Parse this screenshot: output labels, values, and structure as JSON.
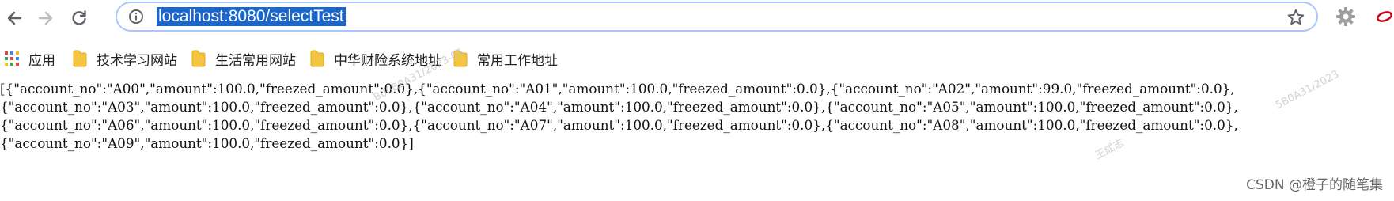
{
  "browser": {
    "url": "localhost:8080/selectTest",
    "icons": {
      "back": "back-arrow-icon",
      "forward": "forward-arrow-icon",
      "reload": "reload-icon",
      "info": "info-icon",
      "bookmark_star": "star-icon",
      "extension": "gear-icon"
    }
  },
  "bookmarks": [
    {
      "label": "应用",
      "icon": "apps-grid-icon"
    },
    {
      "label": "技术学习网站",
      "icon": "folder-icon"
    },
    {
      "label": "生活常用网站",
      "icon": "folder-icon"
    },
    {
      "label": "中华财险系统地址",
      "icon": "folder-icon"
    },
    {
      "label": "常用工作地址",
      "icon": "folder-icon"
    }
  ],
  "content": {
    "lines": [
      "[{\"account_no\":\"A00\",\"amount\":100.0,\"freezed_amount\":0.0},{\"account_no\":\"A01\",\"amount\":100.0,\"freezed_amount\":0.0},{\"account_no\":\"A02\",\"amount\":99.0,\"freezed_amount\":0.0},",
      "{\"account_no\":\"A03\",\"amount\":100.0,\"freezed_amount\":0.0},{\"account_no\":\"A04\",\"amount\":100.0,\"freezed_amount\":0.0},{\"account_no\":\"A05\",\"amount\":100.0,\"freezed_amount\":0.0},",
      "{\"account_no\":\"A06\",\"amount\":100.0,\"freezed_amount\":0.0},{\"account_no\":\"A07\",\"amount\":100.0,\"freezed_amount\":0.0},{\"account_no\":\"A08\",\"amount\":100.0,\"freezed_amount\":0.0},",
      "{\"account_no\":\"A09\",\"amount\":100.0,\"freezed_amount\":0.0}]"
    ]
  },
  "watermark": {
    "text_1": "B06B0A31/2023-05",
    "text_2": "5B0A31/2023",
    "text_3": "王成志"
  },
  "footer": {
    "csdn_credit": "CSDN @橙子的随笔集"
  }
}
